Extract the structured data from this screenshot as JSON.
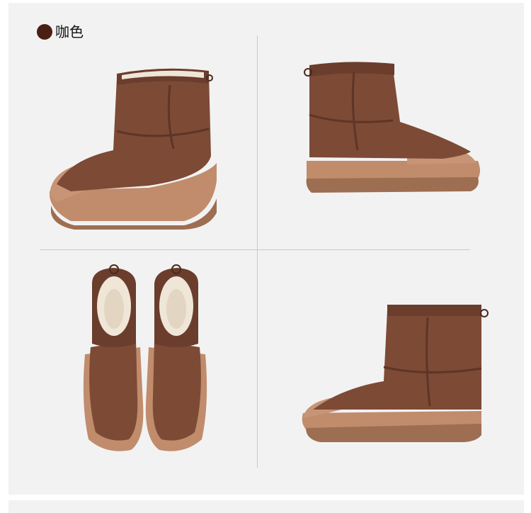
{
  "color_label": "咖色",
  "colors": {
    "swatch": "#4a1f14",
    "suede": "#7d4a36",
    "suede_dark": "#5e3526",
    "cuff": "#6b3d2c",
    "sole": "#c08c6c",
    "sole_dark": "#9e6e52",
    "lining": "#efe6d8"
  },
  "views": [
    "boot-side-left",
    "boot-side-right",
    "boots-top-pair",
    "boot-side-right-lower"
  ]
}
